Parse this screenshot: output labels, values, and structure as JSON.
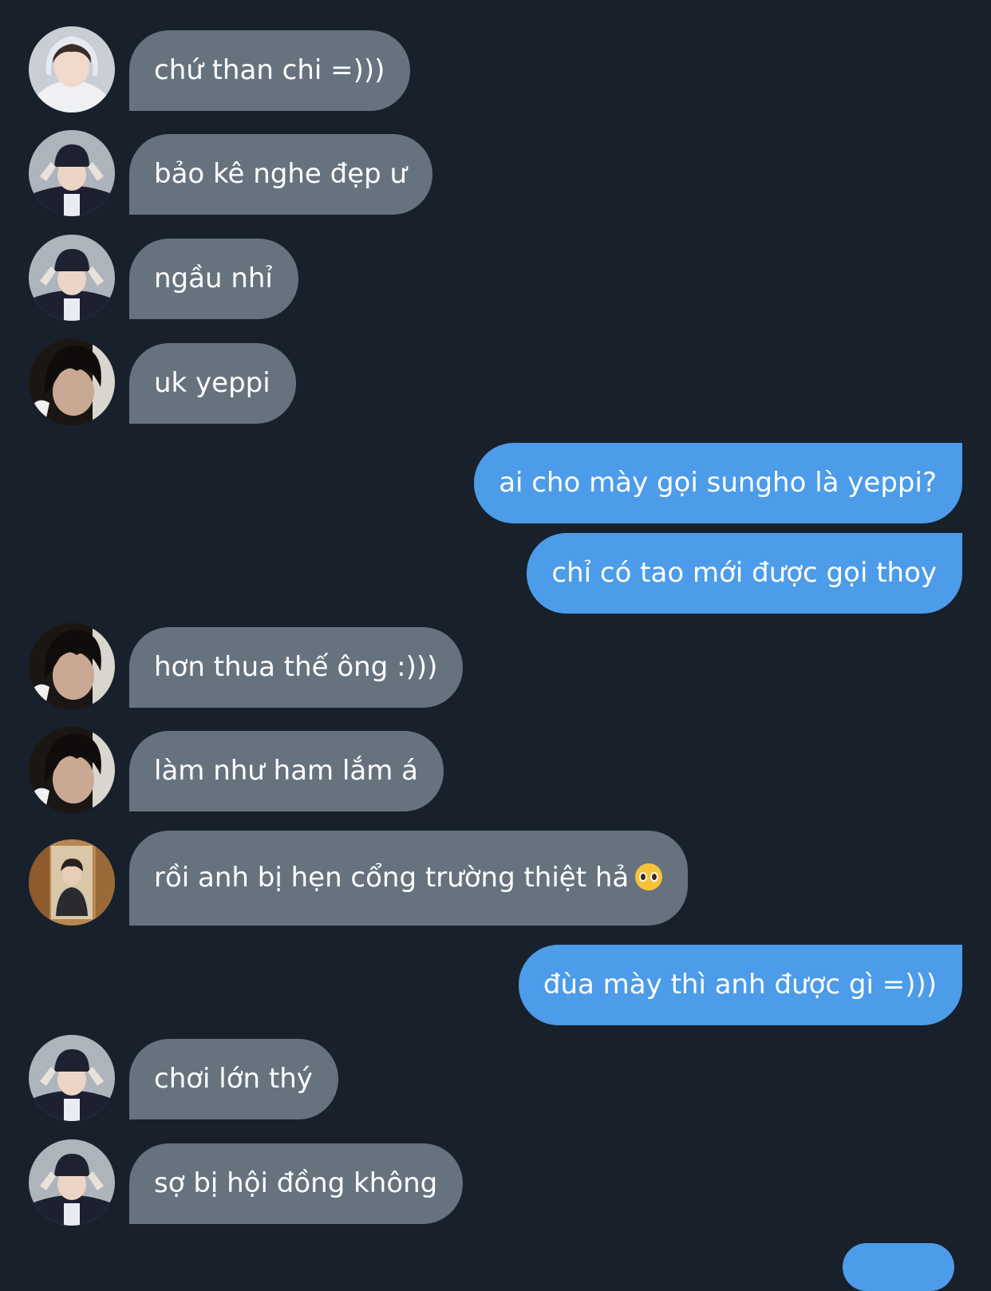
{
  "messages": [
    {
      "side": "in",
      "avatar": "avatar-white-hoodie",
      "text": "chứ than chi =)))"
    },
    {
      "side": "in",
      "avatar": "avatar-beanie",
      "text": "bảo kê nghe đẹp ư"
    },
    {
      "side": "in",
      "avatar": "avatar-beanie",
      "text": "ngầu nhỉ"
    },
    {
      "side": "in",
      "avatar": "avatar-dark-hair",
      "text": "uk yeppi"
    },
    {
      "side": "out",
      "text": "ai cho mày gọi sungho là yeppi?"
    },
    {
      "side": "out",
      "text": "chỉ có tao mới được gọi thoy"
    },
    {
      "side": "in",
      "avatar": "avatar-dark-hair",
      "text": "hơn thua thế ông :)))"
    },
    {
      "side": "in",
      "avatar": "avatar-dark-hair",
      "text": "làm như ham lắm á"
    },
    {
      "side": "in",
      "avatar": "avatar-mirror-selfie",
      "text": "rồi anh bị hẹn cổng trường thiệt hả",
      "emoji": "pleading-face-emoji"
    },
    {
      "side": "out",
      "text": "đùa mày thì anh được gì =)))"
    },
    {
      "side": "in",
      "avatar": "avatar-beanie",
      "text": "chơi lớn thý"
    },
    {
      "side": "in",
      "avatar": "avatar-beanie",
      "text": "sợ bị hội đồng không"
    }
  ],
  "colors": {
    "background": "#18202b",
    "incoming_bubble": "#66737f",
    "outgoing_bubble": "#4c9ce9",
    "text": "#ffffff"
  }
}
